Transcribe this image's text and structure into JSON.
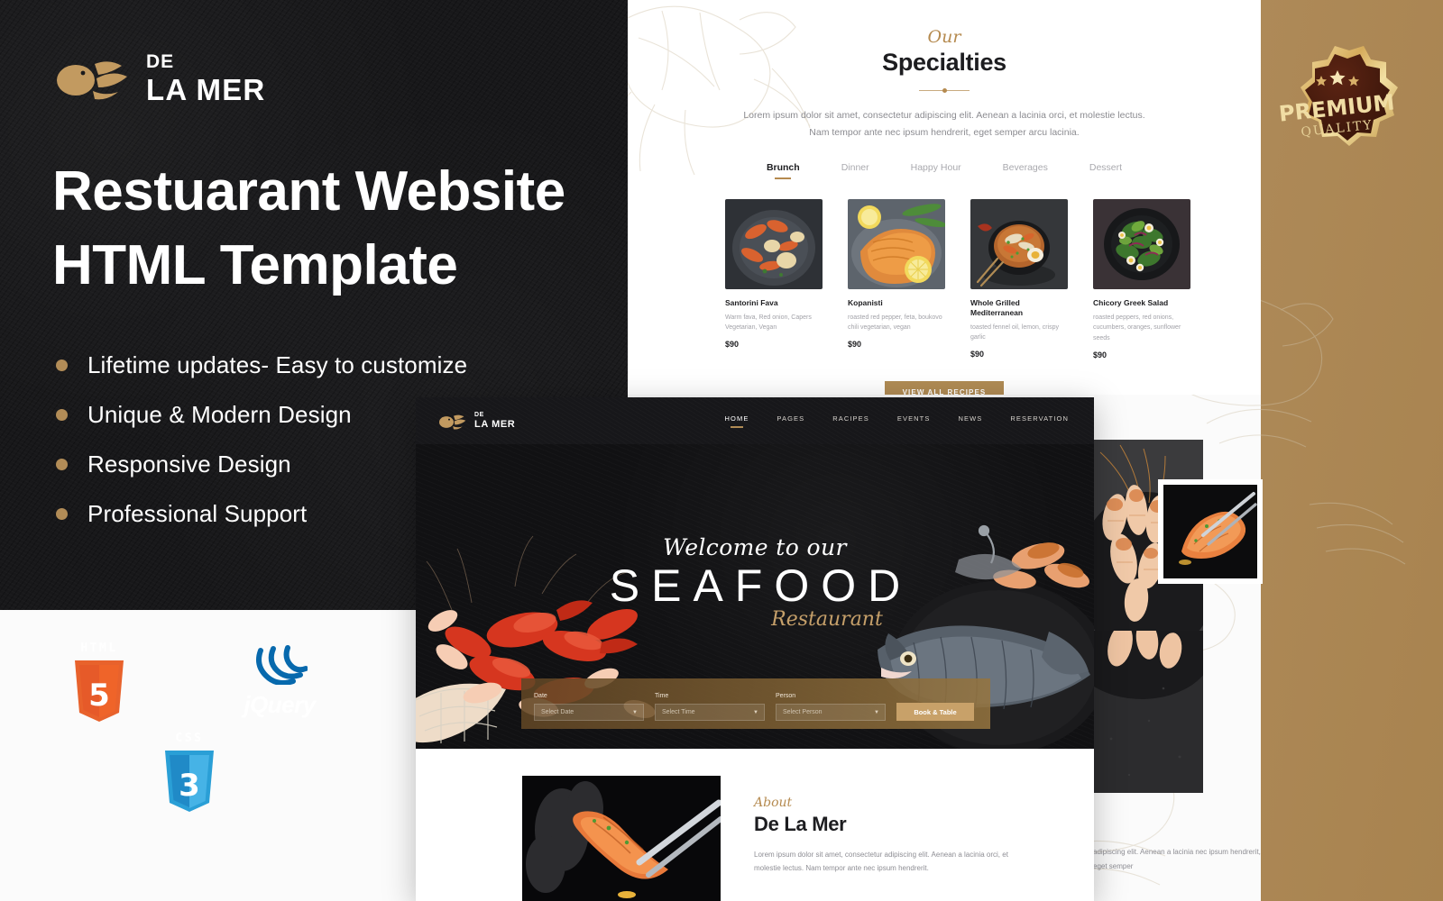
{
  "theme": {
    "gold": "#b08b54",
    "dark": "#18181a",
    "cream": "#fbfbfb",
    "accent_text": "#b58a4f"
  },
  "promo": {
    "brand": {
      "line1": "DE",
      "line2": "LA MER",
      "logo_icon": "fish-icon"
    },
    "headline_line1": "Restuarant Website",
    "headline_line2": "HTML Template",
    "features": [
      "Lifetime updates- Easy to customize",
      "Unique & Modern Design",
      "Responsive Design",
      "Professional Support"
    ],
    "tech_badges": [
      {
        "name": "HTML5",
        "caption": "HTML",
        "digit": "5",
        "icon": "html5-shield-icon",
        "color": "#e8622c"
      },
      {
        "name": "jQuery",
        "caption": "jQuery",
        "icon": "jquery-icon",
        "color": "#0769ad"
      },
      {
        "name": "CSS3",
        "caption": "CSS",
        "digit": "3",
        "icon": "css3-shield-icon",
        "color": "#2a9fd6"
      }
    ],
    "premium_badge": {
      "line1": "PREMIUM",
      "line2": "QUALITY",
      "stars": 3,
      "icon": "premium-seal-icon"
    }
  },
  "specialties_mock": {
    "kicker": "Our",
    "title": "Specialties",
    "description_line1": "Lorem ipsum dolor sit amet, consectetur adipiscing elit. Aenean a lacinia orci, et molestie lectus.",
    "description_line2": "Nam tempor ante nec ipsum hendrerit, eget semper arcu lacinia.",
    "tabs": [
      {
        "label": "Brunch",
        "active": true
      },
      {
        "label": "Dinner",
        "active": false
      },
      {
        "label": "Happy Hour",
        "active": false
      },
      {
        "label": "Beverages",
        "active": false
      },
      {
        "label": "Dessert",
        "active": false
      }
    ],
    "dishes": [
      {
        "name": "Santorini Fava",
        "desc": "Warm fava, Red onion, Capers Vegetarian, Vegan",
        "price": "$90",
        "photo": "shrimp-pan-photo"
      },
      {
        "name": "Kopanisti",
        "desc": "roasted red pepper, feta, boukovo chili vegetarian, vegan",
        "price": "$90",
        "photo": "grilled-salmon-photo"
      },
      {
        "name": "Whole Grilled Mediterranean",
        "desc": "toasted fennel oil, lemon, crispy garlic",
        "price": "$90",
        "photo": "shrimp-soup-photo"
      },
      {
        "name": "Chicory Greek Salad",
        "desc": "roasted peppers, red onions, cucumbers, oranges, sunflower seeds",
        "price": "$90",
        "photo": "greek-salad-photo"
      }
    ],
    "cta_label": "VIEW ALL RECIPES"
  },
  "site_mock": {
    "brand": {
      "line1": "DE",
      "line2": "LA MER"
    },
    "nav": [
      {
        "label": "HOME",
        "active": true
      },
      {
        "label": "PAGES",
        "active": false
      },
      {
        "label": "RACIPES",
        "active": false
      },
      {
        "label": "EVENTS",
        "active": false
      },
      {
        "label": "NEWS",
        "active": false
      },
      {
        "label": "RESERVATION",
        "active": false
      }
    ],
    "hero": {
      "welcome": "Welcome to our",
      "main": "SEAFOOD",
      "script": "Restaurant"
    },
    "booking": {
      "fields": [
        {
          "label": "Date",
          "placeholder": "Select Date"
        },
        {
          "label": "Time",
          "placeholder": "Select Time"
        },
        {
          "label": "Person",
          "placeholder": "Select Person"
        }
      ],
      "button_label": "Book & Table"
    },
    "about": {
      "kicker": "About",
      "title": "De La Mer",
      "text": "Lorem ipsum dolor sit amet, consectetur adipiscing elit. Aenean a lacinia orci, et molestie lectus. Nam tempor ante nec ipsum hendrerit.",
      "photo": "shrimp-chopsticks-photo"
    }
  },
  "right_column": {
    "text": "adipiscing elit. Aenean a lacinia nec ipsum hendrerit, eget semper"
  }
}
